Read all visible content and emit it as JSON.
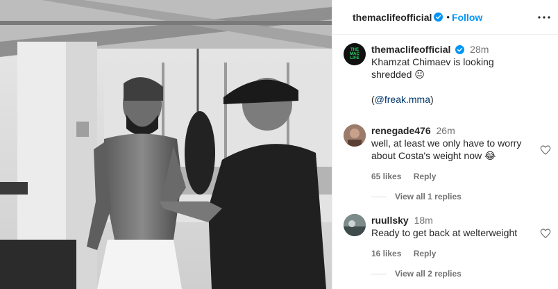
{
  "post": {
    "username": "themaclifeofficial",
    "follow_label": "Follow",
    "separator": "•"
  },
  "caption": {
    "avatar_text": "THE MAC LIFE",
    "username": "themaclifeofficial",
    "time": "28m",
    "text": "Khamzat Chimaev is looking shredded 😐",
    "credit_open": "(",
    "credit_link": "@freak.mma",
    "credit_close": ")"
  },
  "comments": [
    {
      "username": "renegade476",
      "time": "26m",
      "text": "well, at least we only have to worry about Costa's weight now 😂",
      "likes": "65 likes",
      "reply_label": "Reply",
      "view_replies": "View all 1 replies"
    },
    {
      "username": "ruullsky",
      "time": "18m",
      "text": "Ready to get back at welterweight",
      "likes": "16 likes",
      "reply_label": "Reply",
      "view_replies": "View all 2 replies"
    }
  ],
  "colors": {
    "accent": "#0095f6",
    "verified": "#0095f6",
    "secondary_text": "#737373"
  },
  "icons": [
    "verified-badge-icon",
    "more-options-icon",
    "heart-icon"
  ]
}
